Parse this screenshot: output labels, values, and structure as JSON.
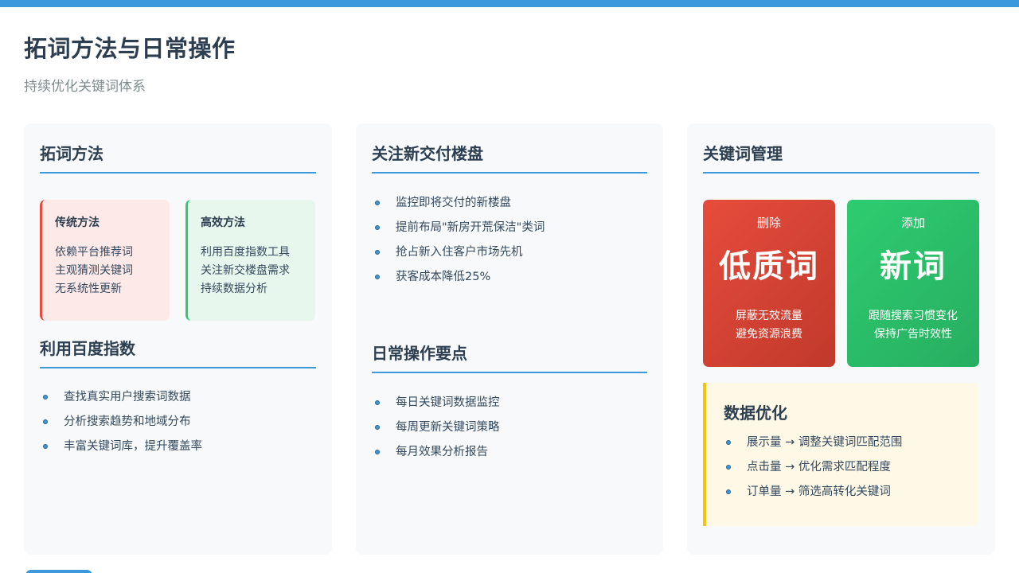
{
  "header": {
    "title": "拓词方法与日常操作",
    "subtitle": "持续优化关键词体系"
  },
  "col1": {
    "section1_title": "拓词方法",
    "traditional": {
      "title": "传统方法",
      "lines": [
        "依赖平台推荐词",
        "主观猜测关键词",
        "无系统性更新"
      ]
    },
    "efficient": {
      "title": "高效方法",
      "lines": [
        "利用百度指数工具",
        "关注新交楼盘需求",
        "持续数据分析"
      ]
    },
    "section2_title": "利用百度指数",
    "bullets": [
      "查找真实用户搜索词数据",
      "分析搜索趋势和地域分布",
      "丰富关键词库，提升覆盖率"
    ]
  },
  "col2": {
    "section1_title": "关注新交付楼盘",
    "bullets1": [
      "监控即将交付的新楼盘",
      "提前布局\"新房开荒保洁\"类词",
      "抢占新入住客户市场先机",
      "获客成本降低25%"
    ],
    "section2_title": "日常操作要点",
    "bullets2": [
      "每日关键词数据监控",
      "每周更新关键词策略",
      "每月效果分析报告"
    ]
  },
  "col3": {
    "section_title": "关键词管理",
    "delete_card": {
      "label": "删除",
      "word": "低质词",
      "lines": [
        "屏蔽无效流量",
        "避免资源浪费"
      ]
    },
    "add_card": {
      "label": "添加",
      "word": "新词",
      "lines": [
        "跟随搜索习惯变化",
        "保持广告时效性"
      ]
    },
    "optimize": {
      "title": "数据优化",
      "bullets": [
        "展示量 → 调整关键词匹配范围",
        "点击量 → 优化需求匹配程度",
        "订单量 → 筛选高转化关键词"
      ]
    }
  },
  "colors": {
    "accent": "#3a98db",
    "red": "#e74c3c",
    "green": "#2ecc71",
    "yellow": "#f1c40f"
  }
}
